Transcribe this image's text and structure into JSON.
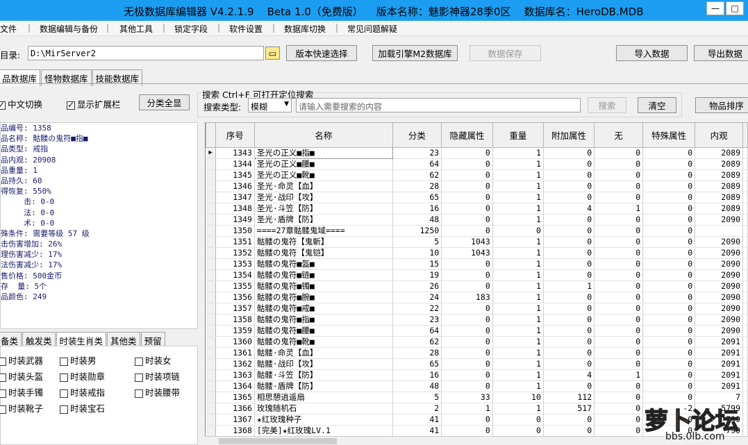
{
  "window": {
    "title": "无极数据库编辑器 V4.2.1.9    Beta 1.0（免费版）    版本名称：魅影神器28季0区    数据库名：HeroDB.MDB",
    "minimize": "—",
    "maximize": "□"
  },
  "menu": [
    "文件",
    "数据编辑与备份",
    "其他工具",
    "锁定字段",
    "软件设置",
    "数据库切换",
    "常见问题解疑"
  ],
  "toolbar": {
    "dir_label": "目录:",
    "dir_value": "D:\\MirServer2",
    "version_select": "版本快速选择",
    "load_m2": "加载引擎M2数据库",
    "save_data": "数据保存",
    "import_data": "导入数据",
    "export_data": "导出数据"
  },
  "db_tabs": [
    "品数据库",
    "怪物数据库",
    "技能数据库"
  ],
  "options": {
    "cn_switch": "中文切换",
    "show_ext": "显示扩展栏",
    "show_all": "分类全显"
  },
  "search": {
    "title": "搜索   Ctrl+F 可打开定位搜索",
    "type_label": "搜索类型:",
    "type_value": "模糊",
    "placeholder": "请输入需要搜索的内容",
    "search_btn": "搜索",
    "clear_btn": "清空",
    "sort_btn": "物品排序"
  },
  "info": [
    "品编号: 1358",
    "品名称: 骷髅の鬼符■指■",
    "品类型: 戒指",
    "品内观: 20908",
    "品重量: 1",
    "品持久: 60",
    "得恢复: 550%",
    "     击: 0-0",
    "     法: 0-0",
    "     术: 0-0",
    "殊条件: 需要等级 57 级",
    "击伤害增加: 26%",
    "理伤害减少: 17%",
    "法伤害减少: 17%",
    "售价格: 500金币",
    "存  量: 5个",
    "品颜色: 249"
  ],
  "cat_tabs": [
    "备类",
    "触发类",
    "时装生肖类",
    "其他类",
    "预留"
  ],
  "cat_checks": [
    [
      "时装武器",
      "时装男",
      "时装女"
    ],
    [
      "时装头盔",
      "时装勋章",
      "时装项链"
    ],
    [
      "时装手镯",
      "时装戒指",
      "时装腰带"
    ],
    [
      "时装靴子",
      "时装宝石"
    ]
  ],
  "table": {
    "headers": [
      "序号",
      "名称",
      "分类",
      "隐藏属性",
      "重量",
      "附加属性",
      "无",
      "特殊属性",
      "内观"
    ],
    "rows": [
      [
        "1343",
        "圣光の正义■指■",
        "23",
        "0",
        "1",
        "0",
        "0",
        "0",
        "2089"
      ],
      [
        "1344",
        "圣光の正义■腰■",
        "64",
        "0",
        "1",
        "0",
        "0",
        "0",
        "2089"
      ],
      [
        "1345",
        "圣光の正义■靴■",
        "62",
        "0",
        "1",
        "0",
        "0",
        "0",
        "2089"
      ],
      [
        "1346",
        "圣光·命灵【血】",
        "28",
        "0",
        "1",
        "0",
        "0",
        "0",
        "2089"
      ],
      [
        "1347",
        "圣光·战印【攻】",
        "65",
        "0",
        "1",
        "0",
        "0",
        "0",
        "2089"
      ],
      [
        "1348",
        "圣光·斗笠【防】",
        "16",
        "0",
        "1",
        "4",
        "1",
        "0",
        "2089"
      ],
      [
        "1349",
        "圣光·盾牌【防】",
        "48",
        "0",
        "1",
        "0",
        "0",
        "0",
        "2090"
      ],
      [
        "1350",
        "====27章骷髅鬼域====",
        "1250",
        "0",
        "0",
        "0",
        "0",
        "0",
        ""
      ],
      [
        "1351",
        "骷髅の鬼符【鬼斬】",
        "5",
        "1043",
        "1",
        "0",
        "0",
        "0",
        "2090"
      ],
      [
        "1352",
        "骷髅の鬼符【鬼铠】",
        "10",
        "1043",
        "1",
        "0",
        "0",
        "0",
        "2090"
      ],
      [
        "1353",
        "骷髅の鬼符■盔■",
        "15",
        "0",
        "1",
        "0",
        "0",
        "0",
        "2090"
      ],
      [
        "1354",
        "骷髅の鬼符■链■",
        "19",
        "0",
        "1",
        "0",
        "0",
        "0",
        "2090"
      ],
      [
        "1355",
        "骷髅の鬼符■镯■",
        "26",
        "0",
        "1",
        "1",
        "0",
        "0",
        "2090"
      ],
      [
        "1356",
        "骷髅の鬼符■腕■",
        "24",
        "183",
        "1",
        "0",
        "0",
        "0",
        "2090"
      ],
      [
        "1357",
        "骷髅の鬼符■戒■",
        "22",
        "0",
        "1",
        "0",
        "0",
        "0",
        "2090"
      ],
      [
        "1358",
        "骷髅の鬼符■指■",
        "23",
        "0",
        "1",
        "0",
        "0",
        "0",
        "2090"
      ],
      [
        "1359",
        "骷髅の鬼符■腰■",
        "64",
        "0",
        "1",
        "0",
        "0",
        "0",
        "2090"
      ],
      [
        "1360",
        "骷髅の鬼符■靴■",
        "62",
        "0",
        "1",
        "0",
        "0",
        "0",
        "2091"
      ],
      [
        "1361",
        "骷髅·命灵【血】",
        "28",
        "0",
        "1",
        "0",
        "0",
        "0",
        "2091"
      ],
      [
        "1362",
        "骷髅·战印【攻】",
        "65",
        "0",
        "1",
        "0",
        "0",
        "0",
        "2091"
      ],
      [
        "1363",
        "骷髅·斗笠【防】",
        "16",
        "0",
        "1",
        "4",
        "1",
        "0",
        "2091"
      ],
      [
        "1364",
        "骷髅·盾牌【防】",
        "48",
        "0",
        "1",
        "0",
        "0",
        "0",
        "2091"
      ],
      [
        "1365",
        "相思憩逍遥扇",
        "5",
        "33",
        "10",
        "112",
        "0",
        "0",
        "7"
      ],
      [
        "1366",
        "玫瑰随机石",
        "2",
        "1",
        "1",
        "517",
        "0",
        "-2",
        "5799"
      ],
      [
        "1367",
        "★红玫瑰种子",
        "41",
        "0",
        "0",
        "0",
        "0",
        "0",
        "799"
      ],
      [
        "1368",
        "[完美]★红玫瑰LV.1",
        "41",
        "0",
        "0",
        "0",
        "0",
        "0",
        "799"
      ]
    ]
  },
  "watermark": {
    "text": "萝卜论坛",
    "url": "bbs.0lb.com"
  }
}
